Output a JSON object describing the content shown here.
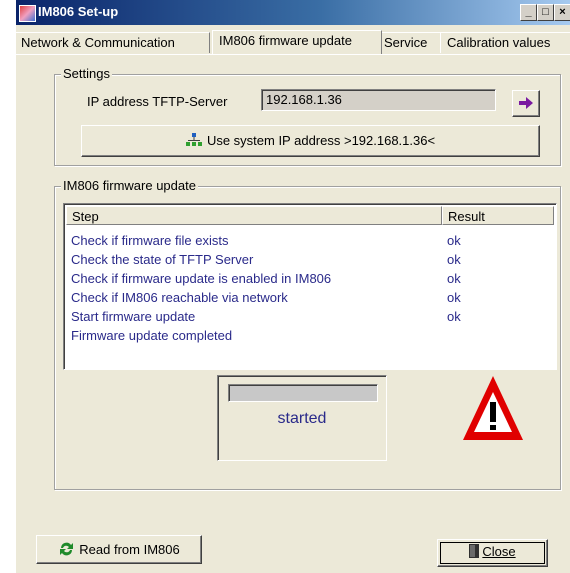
{
  "window": {
    "title": "IM806 Set-up",
    "minimize_glyph": "_",
    "maximize_glyph": "□",
    "close_glyph": "×"
  },
  "tabs": [
    {
      "label": "Network & Communication",
      "active": false
    },
    {
      "label": "IM806 firmware update",
      "active": true
    },
    {
      "label": "Service",
      "active": false
    },
    {
      "label": "Calibration values",
      "active": false
    }
  ],
  "settings": {
    "legend": "Settings",
    "ip_label": "IP address TFTP-Server",
    "ip_value": "192.168.1.36",
    "apply_icon": "arrow-right-icon",
    "use_system_ip_label": "Use system IP address >192.168.1.36<",
    "use_system_ip_icon": "network-icon"
  },
  "update": {
    "legend": "IM806 firmware update",
    "columns": [
      "Step",
      "Result"
    ],
    "steps": [
      {
        "step": "Check if firmware file exists",
        "result": "ok"
      },
      {
        "step": "Check the state of TFTP Server",
        "result": "ok"
      },
      {
        "step": "Check if firmware update is enabled in IM806",
        "result": "ok"
      },
      {
        "step": "Check if IM806 reachable via network",
        "result": "ok"
      },
      {
        "step": "Start firmware update",
        "result": "ok"
      },
      {
        "step": "Firmware update completed",
        "result": ""
      }
    ],
    "progress_fraction": 0,
    "status": "started",
    "warning_icon": "warning-icon"
  },
  "footer": {
    "read_label": "Read from IM806",
    "read_icon": "refresh-icon",
    "close_label": "Close",
    "close_icon": "door-icon"
  },
  "colors": {
    "list_text": "#2a2a8a",
    "titlebar": "#0a246a",
    "warning": "#e00000"
  }
}
